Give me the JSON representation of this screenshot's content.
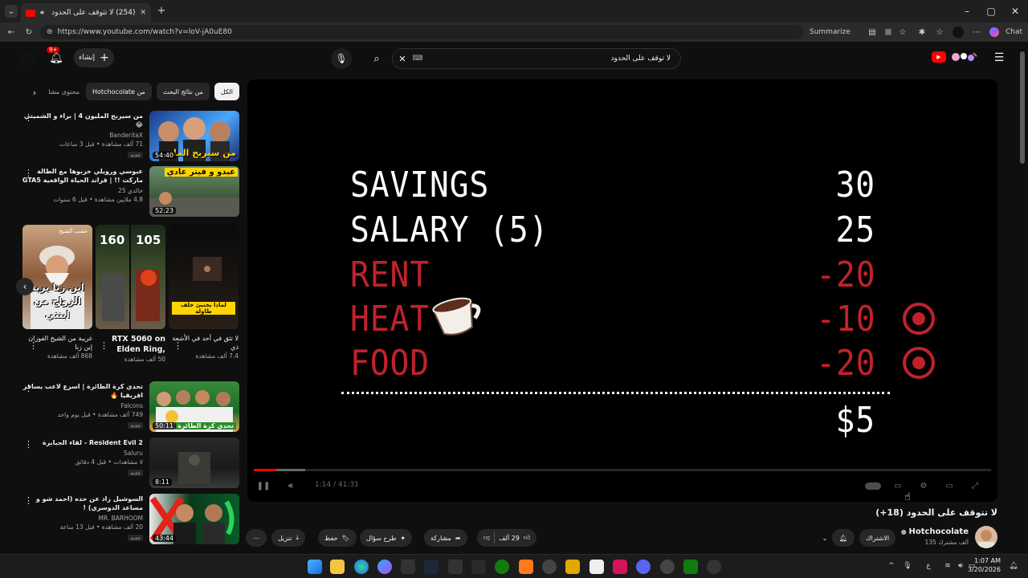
{
  "browser": {
    "tab_title": "(254) لا تتوقف على الحدود (18+)",
    "url": "https://www.youtube.com/watch?v=loV-jA0uE80",
    "summarize_label": "Summarize",
    "chat_label": "Chat"
  },
  "header": {
    "create_label": "إنشاء",
    "notification_count": "9+",
    "search_value": "لا توقف على الحدود"
  },
  "chips": [
    "الكل",
    "من نتائج البحث",
    "من Hotchocolate",
    "محتوى مشا"
  ],
  "related": [
    {
      "title": "من سيربح المليون 4 | براء و الشميتي 😂",
      "channel": "BanderitaX",
      "meta": "71 ألف مشاهدة • قبل 3 ساعات",
      "badge": "جديد",
      "duration": "54:40",
      "thumb_text": "من سيربح الملي"
    },
    {
      "title": "عبوسي ورويلي خربوها مع الطالة ماركت !! | قراند الحياة الواقعية GTA5",
      "channel": "خالدي 25",
      "meta": "4.8 ملايين مشاهدة • قبل 6 سنوات",
      "badge": "",
      "duration": "52:23",
      "thumb_text": "عبدو و فيتر عادي"
    },
    {
      "title": "تحدي كرة الطائرة | اسرع لاعب يسافر افريقيا 🔥",
      "channel": "Falcons",
      "meta": "749 ألف مشاهدة • قبل يوم واحد",
      "badge": "جديد",
      "duration": "50:11",
      "thumb_text": "تحدي كرة الطائرة"
    },
    {
      "title": "Resident Evil 2 - لقاء الجبابرة",
      "channel": "Saluru",
      "meta": "لا مشاهدات • قبل 4 دقائق",
      "badge": "جديد",
      "duration": "8:11",
      "thumb_text": ""
    },
    {
      "title": "السوشيل زاد عن حده (احمد شو و مساعد الدوسري) !",
      "channel": "MR. BARHOOM",
      "meta": "20 ألف مشاهدة • قبل 13 ساعة",
      "badge": "جديد",
      "duration": "43:44",
      "thumb_text": ""
    }
  ],
  "shorts": [
    {
      "title": "غريبة من الشيخ الفوزان إبن زنا",
      "meta": "868 ألف مشاهدة",
      "thumb_text": "ابن زنا يريد الزواج من ابنتي",
      "top_text": "غضب الشيخ"
    },
    {
      "title": "RTX 5060 on Elden Ring,",
      "meta": "50 ألف مشاهدة",
      "fps_left": "160",
      "fps_right": "105"
    },
    {
      "title": "لا تثق في أحد في الأشعة ذي",
      "meta": "7.4 ألف مشاهدة",
      "thumb_text": "لماذا يختبئ خلف طاولة"
    }
  ],
  "player": {
    "rows": [
      {
        "label": "SAVINGS",
        "value": "30",
        "color": "white",
        "check": false
      },
      {
        "label": "SALARY (5)",
        "value": "25",
        "color": "white",
        "check": false
      },
      {
        "label": "RENT",
        "value": "-20",
        "color": "red",
        "check": false
      },
      {
        "label": "HEAT",
        "value": "-10",
        "color": "red",
        "check": true
      },
      {
        "label": "FOOD",
        "value": "-20",
        "color": "red",
        "check": true
      }
    ],
    "total": "$5",
    "time": "1:14 / 41:31",
    "progress": 0.03,
    "buffer": 0.07
  },
  "video": {
    "title": "لا تتوقف على الحدود (18+)",
    "channel": "Hotchocolate",
    "subscribers": "135 ألف مشترك",
    "subscribe_label": "الاشتراك",
    "likes": "29 ألف",
    "share_label": "مشاركة",
    "ask_label": "طرح سؤال",
    "save_label": "حفظ",
    "download_label": "تنزيل"
  },
  "taskbar": {
    "time": "1:07 AM",
    "date": "3/20/2026",
    "lang": "ع"
  },
  "colors": {
    "accent": "#ff0000",
    "game_red": "#c0222c",
    "bg": "#0f0f0f"
  }
}
